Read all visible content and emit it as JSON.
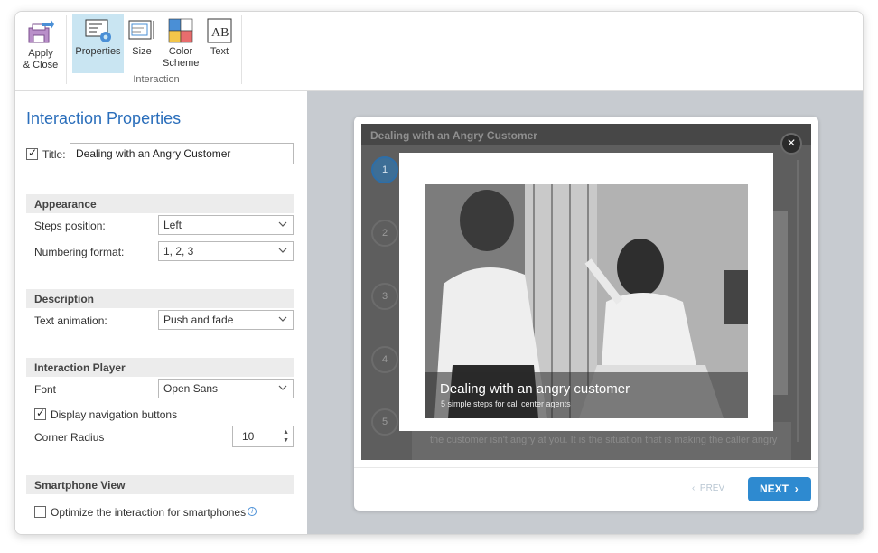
{
  "ribbon": {
    "apply_close_label_line1": "Apply",
    "apply_close_label_line2": "& Close",
    "properties_label": "Properties",
    "size_label": "Size",
    "color_scheme_line1": "Color",
    "color_scheme_line2": "Scheme",
    "text_label": "Text",
    "text_icon_glyph": "AB",
    "group_label": "Interaction"
  },
  "panel": {
    "heading": "Interaction Properties",
    "title_label": "Title:",
    "title_value": "Dealing with an Angry Customer",
    "title_checked": true,
    "appearance": {
      "section": "Appearance",
      "steps_position_label": "Steps position:",
      "steps_position_value": "Left",
      "numbering_format_label": "Numbering format:",
      "numbering_format_value": "1, 2, 3"
    },
    "description": {
      "section": "Description",
      "text_animation_label": "Text animation:",
      "text_animation_value": "Push and fade"
    },
    "player": {
      "section": "Interaction Player",
      "font_label": "Font",
      "font_value": "Open Sans",
      "display_nav_label": "Display navigation buttons",
      "display_nav_checked": true,
      "corner_radius_label": "Corner Radius",
      "corner_radius_value": "10"
    },
    "smartphone": {
      "section": "Smartphone View",
      "optimize_label": "Optimize the interaction for smartphones",
      "optimize_checked": false
    }
  },
  "preview": {
    "header_title": "Dealing with an Angry Customer",
    "steps": [
      "1",
      "2",
      "3",
      "4",
      "5"
    ],
    "current_step": "1",
    "background_text_line1": "t",
    "background_text_line2": "the customer isn't angry at you. It is the situation that is making the caller angry",
    "close_glyph": "×",
    "popup_title": "Dealing with an angry customer",
    "popup_subtitle": "5 simple steps for call center agents",
    "prev_label": "PREV",
    "next_label": "NEXT"
  },
  "colors": {
    "accent_blue": "#2e8ad0",
    "heading_blue": "#2a6ebb",
    "ribbon_active": "#c9e5f2",
    "preview_bg": "#c7cbd0"
  }
}
